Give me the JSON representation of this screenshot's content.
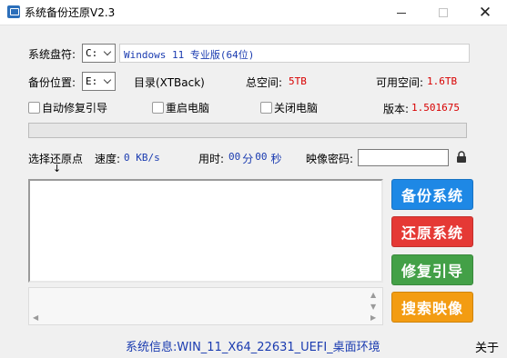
{
  "window": {
    "title": "系统备份还原V2.3",
    "close_glyph": "✕"
  },
  "drive": {
    "label": "系统盘符:",
    "selected": "C:",
    "os_info": "Windows 11 专业版(64位)"
  },
  "backup": {
    "location_label": "备份位置:",
    "location_selected": "E:",
    "dir_label": "目录(XTBack)",
    "total_label": "总空间:",
    "total_value": "5TB",
    "free_label": "可用空间:",
    "free_value": "1.6TB"
  },
  "options": {
    "auto_repair": "自动修复引导",
    "restart": "重启电脑",
    "shutdown": "关闭电脑",
    "version_label": "版本:",
    "version_value": "1.501675"
  },
  "progress": {
    "value": 0
  },
  "restore": {
    "select_label": "选择还原点",
    "arrow": "↓",
    "speed_label": "速度:",
    "speed_value": "0 KB/s",
    "elapsed_label": "用时:",
    "elapsed_min": "00",
    "elapsed_min_unit": "分",
    "elapsed_sec": "00",
    "elapsed_sec_unit": "秒",
    "password_label": "映像密码:"
  },
  "actions": {
    "backup": "备份系统",
    "restore": "还原系统",
    "repair": "修复引导",
    "search": "搜索映像"
  },
  "colors": {
    "backup": "#1e88e5",
    "restore": "#e53935",
    "repair": "#43a047",
    "search": "#f39c12"
  },
  "footer": {
    "system_info": "系统信息:WIN_11_X64_22631_UEFI_桌面环境",
    "about": "关于"
  }
}
